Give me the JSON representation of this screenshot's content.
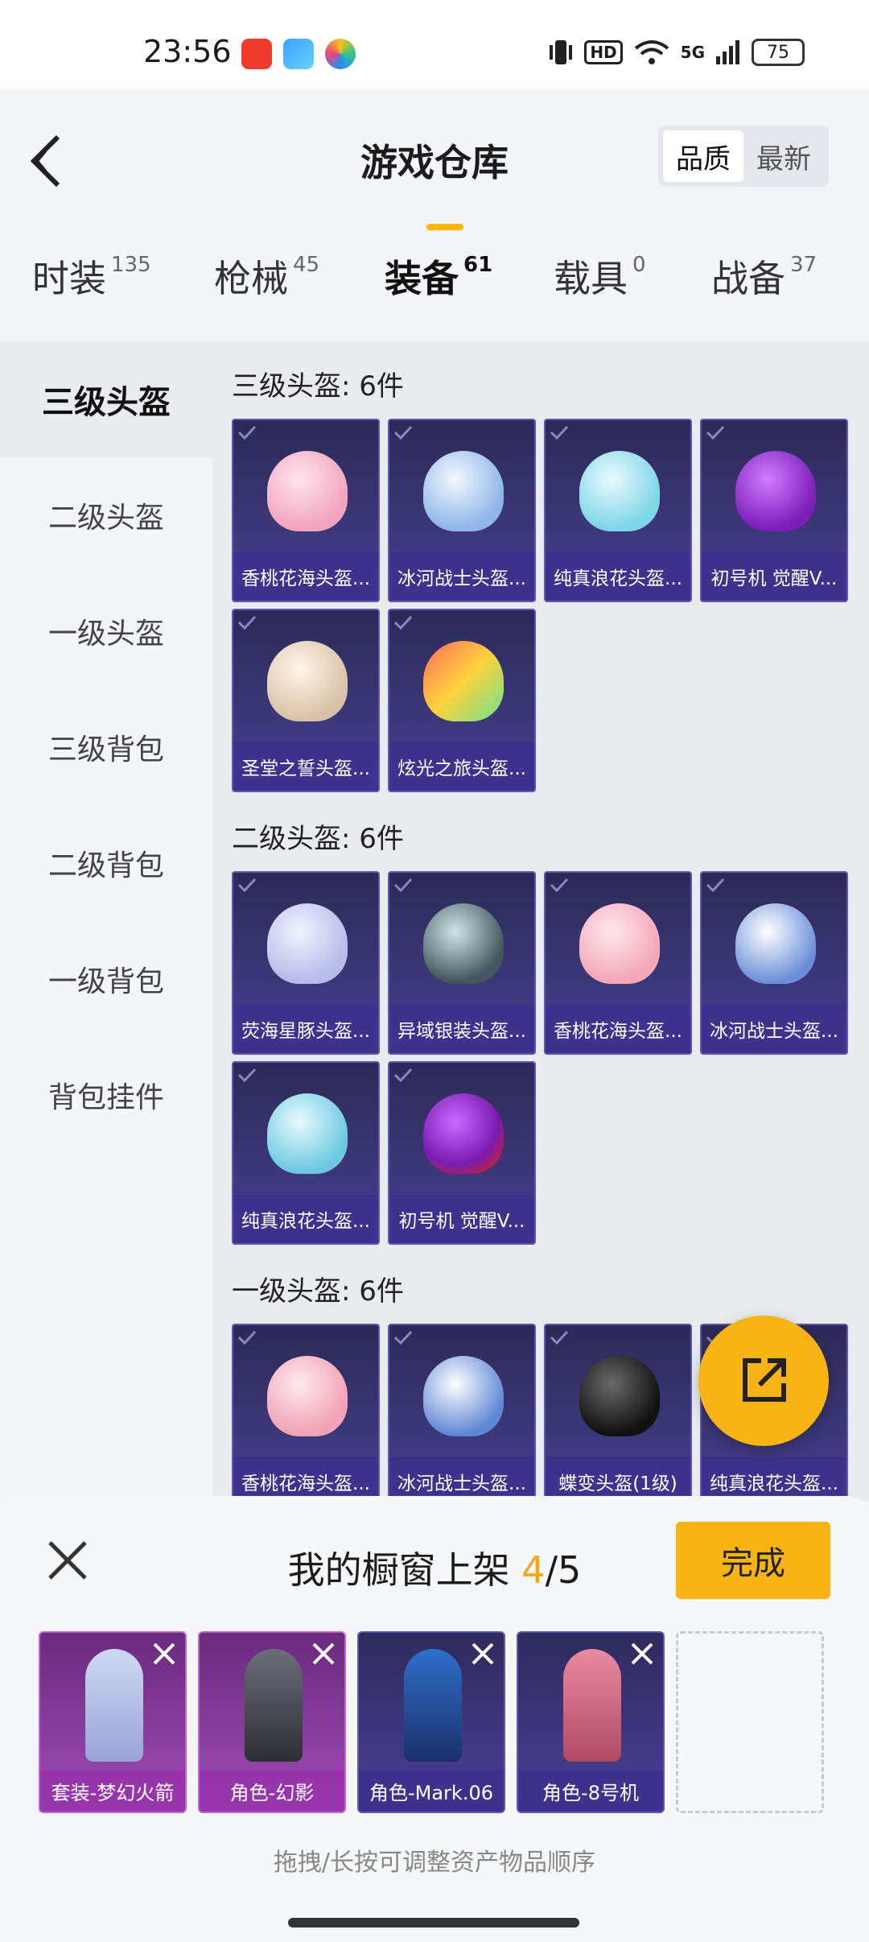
{
  "status": {
    "time": "23:56",
    "hd": "HD",
    "network": "5G",
    "battery": "75"
  },
  "header": {
    "title": "游戏仓库",
    "sort": [
      {
        "label": "品质",
        "active": true
      },
      {
        "label": "最新",
        "active": false
      }
    ]
  },
  "tabs": [
    {
      "label": "时装",
      "count": "135"
    },
    {
      "label": "枪械",
      "count": "45"
    },
    {
      "label": "装备",
      "count": "61"
    },
    {
      "label": "载具",
      "count": "0"
    },
    {
      "label": "战备",
      "count": "37"
    }
  ],
  "sidebar": [
    "三级头盔",
    "二级头盔",
    "一级头盔",
    "三级背包",
    "二级背包",
    "一级背包",
    "背包挂件"
  ],
  "sections": [
    {
      "title": "三级头盔: 6件",
      "items": [
        "香桃花海头盔...",
        "冰河战士头盔...",
        "纯真浪花头盔...",
        "初号机 觉醒V...",
        "圣堂之誓头盔...",
        "炫光之旅头盔..."
      ]
    },
    {
      "title": "二级头盔: 6件",
      "items": [
        "荧海星豚头盔...",
        "异域银装头盔...",
        "香桃花海头盔...",
        "冰河战士头盔...",
        "纯真浪花头盔...",
        "初号机 觉醒V..."
      ]
    },
    {
      "title": "一级头盔: 6件",
      "items": [
        "香桃花海头盔...",
        "冰河战士头盔...",
        "蝶变头盔(1级)",
        "纯真浪花头盔..."
      ]
    }
  ],
  "sheet": {
    "title_prefix": "我的橱窗上架 ",
    "count": "4",
    "total": "/5",
    "done_label": "完成",
    "slots": [
      "套装-梦幻火箭",
      "角色-幻影",
      "角色-Mark.06",
      "角色-8号机"
    ],
    "hint": "拖拽/长按可调整资产物品顺序"
  },
  "colors": {
    "accent": "#f8b314",
    "card_bg": "#3b3676",
    "pink_card": "#a04bb6"
  }
}
